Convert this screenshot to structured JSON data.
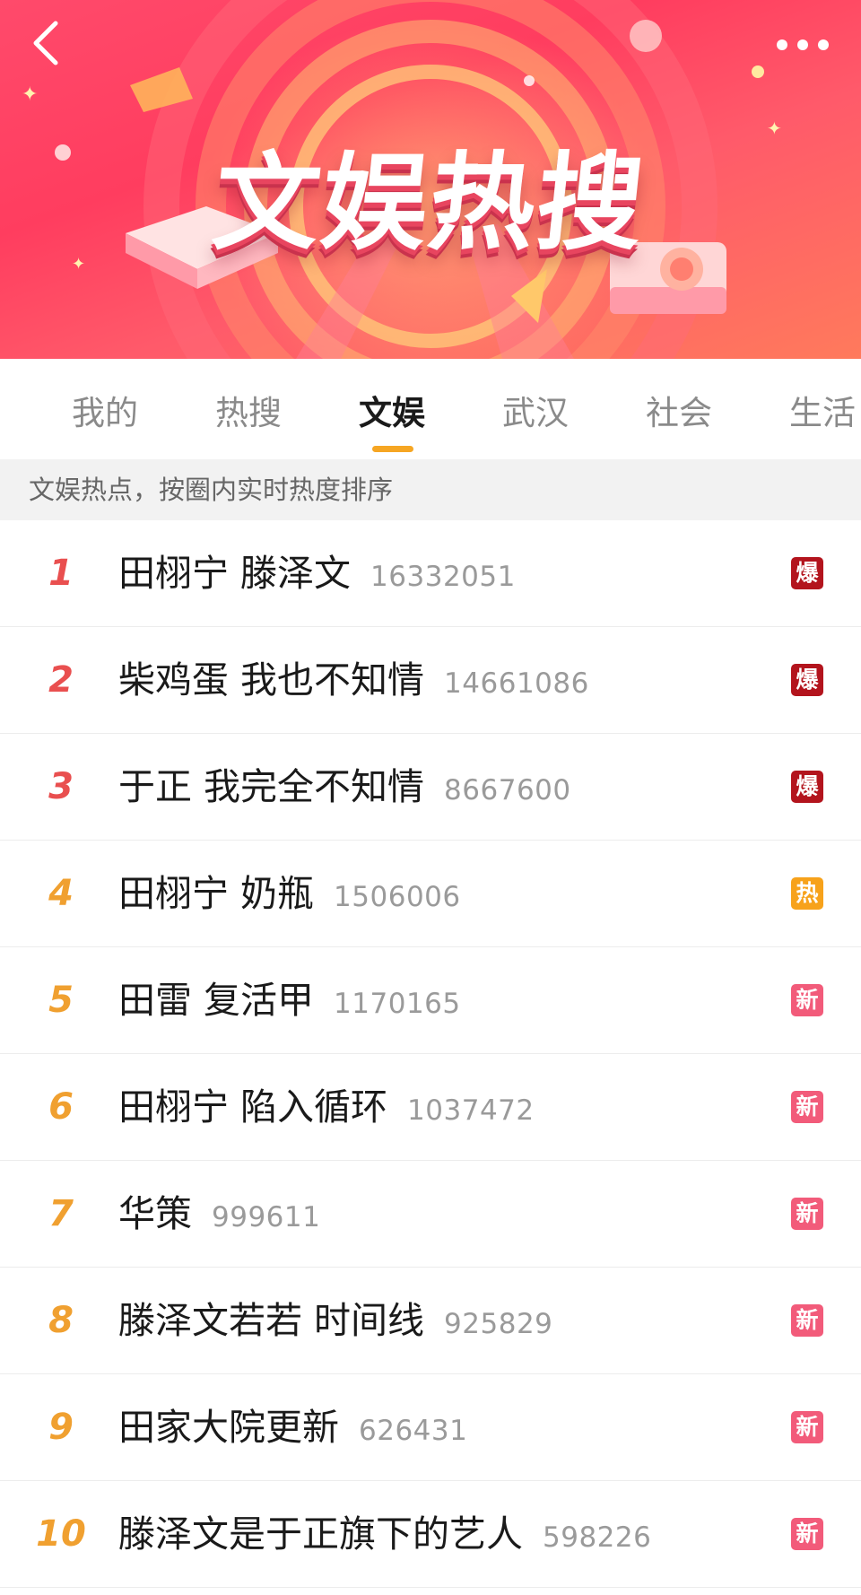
{
  "banner": {
    "title": "文娱热搜"
  },
  "nav": {
    "back_icon": "chevron-left-icon",
    "more_icon": "more-dots-icon"
  },
  "tabs": [
    {
      "label": "我的",
      "active": false
    },
    {
      "label": "热搜",
      "active": false
    },
    {
      "label": "文娱",
      "active": true
    },
    {
      "label": "武汉",
      "active": false
    },
    {
      "label": "社会",
      "active": false
    },
    {
      "label": "生活",
      "active": false
    }
  ],
  "subheader": {
    "text": "文娱热点，按圈内实时热度排序"
  },
  "colors": {
    "rank_top": "#e94f4f",
    "rank_rest": "#f0a030",
    "badge_explode": "#b3141d",
    "badge_hot": "#f7a21b",
    "badge_new": "#f25b7a",
    "tab_indicator": "#f6a623"
  },
  "list": [
    {
      "rank": "1",
      "topic": "田栩宁 滕泽文",
      "count": "16332051",
      "badge": "爆",
      "badge_type": "explode"
    },
    {
      "rank": "2",
      "topic": "柴鸡蛋 我也不知情",
      "count": "14661086",
      "badge": "爆",
      "badge_type": "explode"
    },
    {
      "rank": "3",
      "topic": "于正 我完全不知情",
      "count": "8667600",
      "badge": "爆",
      "badge_type": "explode"
    },
    {
      "rank": "4",
      "topic": "田栩宁 奶瓶",
      "count": "1506006",
      "badge": "热",
      "badge_type": "hot"
    },
    {
      "rank": "5",
      "topic": "田雷 复活甲",
      "count": "1170165",
      "badge": "新",
      "badge_type": "new"
    },
    {
      "rank": "6",
      "topic": "田栩宁 陷入循环",
      "count": "1037472",
      "badge": "新",
      "badge_type": "new"
    },
    {
      "rank": "7",
      "topic": "华策",
      "count": "999611",
      "badge": "新",
      "badge_type": "new"
    },
    {
      "rank": "8",
      "topic": "滕泽文若若 时间线",
      "count": "925829",
      "badge": "新",
      "badge_type": "new"
    },
    {
      "rank": "9",
      "topic": "田家大院更新",
      "count": "626431",
      "badge": "新",
      "badge_type": "new"
    },
    {
      "rank": "10",
      "topic": "滕泽文是于正旗下的艺人",
      "count": "598226",
      "badge": "新",
      "badge_type": "new"
    }
  ]
}
